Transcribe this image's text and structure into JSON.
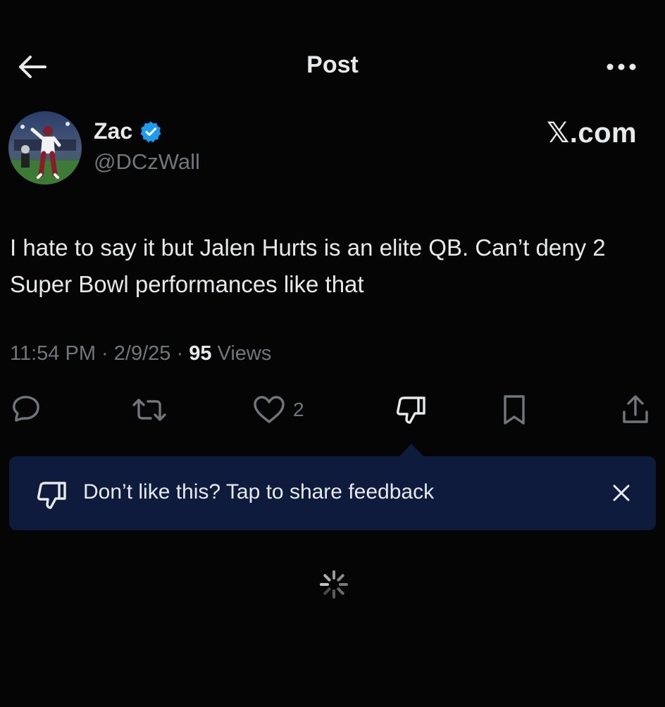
{
  "header": {
    "title": "Post",
    "back_icon": "arrow-left-icon",
    "more_icon": "more-horizontal-icon"
  },
  "author": {
    "name": "Zac",
    "handle": "@DCzWall",
    "verified": true,
    "verified_color": "#1d9bf0",
    "avatar_description": "football-player-avatar"
  },
  "brand": "𝕏.com",
  "tweet": {
    "text": "I hate to say it but Jalen Hurts is an elite QB. Can’t deny 2 Super Bowl performances like that",
    "time": "11:54 PM",
    "date": "2/9/25",
    "separator": " · ",
    "views_count": "95",
    "views_label": " Views"
  },
  "actions": {
    "reply_icon": "reply-icon",
    "retweet_icon": "retweet-icon",
    "like_icon": "heart-icon",
    "like_count": "2",
    "dislike_icon": "thumbs-down-icon",
    "bookmark_icon": "bookmark-icon",
    "share_icon": "share-icon"
  },
  "feedback_banner": {
    "text": "Don’t like this? Tap to share feedback",
    "background": "#0e1b3c",
    "close_icon": "close-icon"
  },
  "loading_icon": "spinner-icon",
  "colors": {
    "background": "#050505",
    "text": "#e7e9ea",
    "muted": "#71767b"
  }
}
